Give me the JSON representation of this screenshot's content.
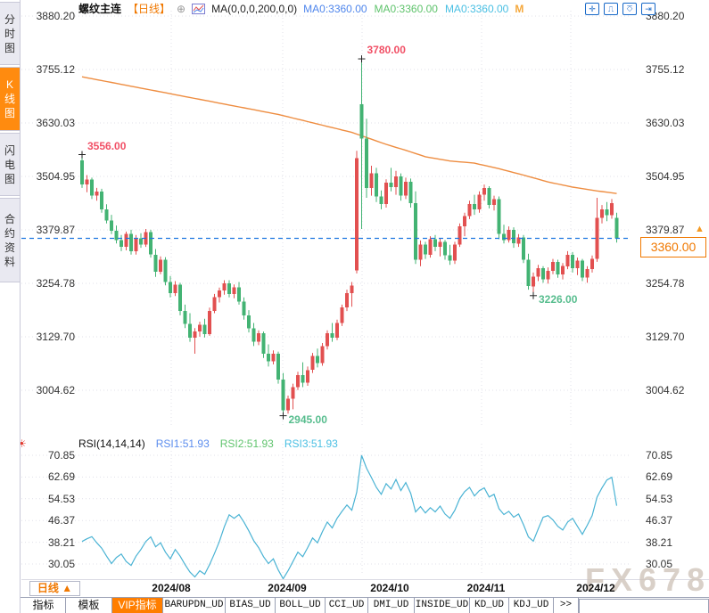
{
  "header": {
    "symbol": "螺纹主连",
    "period_tag": "【日线】",
    "add_icon": "⊕",
    "ma_settings": "MA(0,0,0,200,0,0)",
    "ma_values": [
      {
        "text": "MA0:3360.00",
        "color": "#4f86ec"
      },
      {
        "text": "MA0:3360.00",
        "color": "#5fc36c"
      },
      {
        "text": "MA0:3360.00",
        "color": "#49bfe3"
      }
    ],
    "m_label": "M",
    "toolbar_icons": [
      {
        "name": "pan-tool-icon",
        "glyph": "✛"
      },
      {
        "name": "axis-zoom-icon",
        "glyph": "⎍"
      },
      {
        "name": "axis-pan-icon",
        "glyph": "⎏"
      },
      {
        "name": "exit-chart-icon",
        "glyph": "⇥"
      }
    ]
  },
  "sidebar": {
    "tabs": [
      {
        "label": "分时图",
        "active": false
      },
      {
        "label": "K线图",
        "active": true
      },
      {
        "label": "闪电图",
        "active": false
      },
      {
        "label": "合约资料",
        "active": false
      }
    ]
  },
  "main_chart": {
    "y_labels": [
      "3880.20",
      "3755.12",
      "3630.03",
      "3504.95",
      "3379.87",
      "3254.78",
      "3129.70",
      "3004.62"
    ],
    "current_price": {
      "value": "3360.00",
      "arrow": "▲"
    },
    "annotations": [
      {
        "text": "3556.00",
        "index": 0,
        "price": 3556,
        "placement": "above",
        "color": "#f15066"
      },
      {
        "text": "3780.00",
        "index": 57,
        "price": 3780,
        "placement": "above",
        "color": "#f15066"
      },
      {
        "text": "2945.00",
        "index": 41,
        "price": 2945,
        "placement": "below",
        "color": "#57bd8e"
      },
      {
        "text": "3226.00",
        "index": 92,
        "price": 3226,
        "placement": "below",
        "color": "#57bd8e"
      }
    ]
  },
  "rsi_panel": {
    "title": "RSI(14,14,14)",
    "legend": [
      {
        "text": "RSI1:51.93",
        "color": "#5b8dee"
      },
      {
        "text": "RSI2:51.93",
        "color": "#5fc36c"
      },
      {
        "text": "RSI3:51.93",
        "color": "#49bfe3"
      }
    ],
    "y_labels": [
      "70.85",
      "62.69",
      "54.53",
      "46.37",
      "38.21",
      "30.05"
    ]
  },
  "x_axis": {
    "period_button": "日线 ▲",
    "labels": [
      "2024/08",
      "2024/09",
      "2024/10",
      "2024/11",
      "2024/12"
    ]
  },
  "bottom_tabs": {
    "items": [
      {
        "label": "指标",
        "active": false
      },
      {
        "label": "模板",
        "active": false
      },
      {
        "label": "VIP指标",
        "active": true
      },
      {
        "label": "BARUPDN_UD",
        "active": false
      },
      {
        "label": "BIAS_UD",
        "active": false
      },
      {
        "label": "BOLL_UD",
        "active": false
      },
      {
        "label": "CCI_UD",
        "active": false
      },
      {
        "label": "DMI_UD",
        "active": false
      },
      {
        "label": "INSIDE_UD",
        "active": false
      },
      {
        "label": "KD_UD",
        "active": false
      },
      {
        "label": "KDJ_UD",
        "active": false
      },
      {
        "label": ">>",
        "active": false
      }
    ]
  },
  "watermark": "FX678",
  "colors": {
    "up": "#e25050",
    "down": "#43b373",
    "ma_line": "#ee8d41",
    "rsi_line": "#4ab3d4",
    "price_line": "#1d77e0",
    "grid": "#e1e1ea",
    "accent_orange": "#f07800"
  },
  "chart_data": {
    "type": "candlestick",
    "symbol": "螺纹主连",
    "period": "日线",
    "y_range": [
      3004.62,
      3880.2
    ],
    "rsi_range": [
      30.05,
      70.85
    ],
    "candles": [
      [
        3542,
        3556,
        3478,
        3486
      ],
      [
        3486,
        3508,
        3468,
        3498
      ],
      [
        3498,
        3502,
        3452,
        3460
      ],
      [
        3460,
        3478,
        3448,
        3470
      ],
      [
        3470,
        3476,
        3420,
        3428
      ],
      [
        3428,
        3440,
        3395,
        3402
      ],
      [
        3402,
        3415,
        3370,
        3378
      ],
      [
        3378,
        3390,
        3348,
        3356
      ],
      [
        3356,
        3368,
        3330,
        3340
      ],
      [
        3340,
        3376,
        3332,
        3370
      ],
      [
        3370,
        3380,
        3322,
        3330
      ],
      [
        3330,
        3368,
        3322,
        3360
      ],
      [
        3360,
        3372,
        3338,
        3345
      ],
      [
        3345,
        3382,
        3340,
        3375
      ],
      [
        3375,
        3380,
        3315,
        3322
      ],
      [
        3322,
        3335,
        3270,
        3282
      ],
      [
        3282,
        3318,
        3276,
        3310
      ],
      [
        3310,
        3316,
        3250,
        3258
      ],
      [
        3258,
        3272,
        3222,
        3232
      ],
      [
        3232,
        3260,
        3225,
        3252
      ],
      [
        3252,
        3256,
        3180,
        3190
      ],
      [
        3190,
        3205,
        3150,
        3160
      ],
      [
        3160,
        3185,
        3118,
        3128
      ],
      [
        3128,
        3150,
        3090,
        3142
      ],
      [
        3142,
        3165,
        3130,
        3158
      ],
      [
        3158,
        3172,
        3128,
        3136
      ],
      [
        3136,
        3198,
        3132,
        3190
      ],
      [
        3190,
        3230,
        3185,
        3222
      ],
      [
        3222,
        3245,
        3210,
        3238
      ],
      [
        3238,
        3262,
        3228,
        3255
      ],
      [
        3255,
        3262,
        3222,
        3230
      ],
      [
        3230,
        3252,
        3220,
        3245
      ],
      [
        3245,
        3258,
        3205,
        3212
      ],
      [
        3212,
        3222,
        3170,
        3180
      ],
      [
        3180,
        3192,
        3140,
        3150
      ],
      [
        3150,
        3162,
        3108,
        3118
      ],
      [
        3118,
        3145,
        3110,
        3138
      ],
      [
        3138,
        3142,
        3080,
        3090
      ],
      [
        3090,
        3112,
        3060,
        3072
      ],
      [
        3072,
        3098,
        3065,
        3090
      ],
      [
        3090,
        3095,
        3020,
        3030
      ],
      [
        3030,
        3045,
        2945,
        2958
      ],
      [
        2958,
        2992,
        2950,
        2985
      ],
      [
        2985,
        3020,
        2960,
        3012
      ],
      [
        3012,
        3048,
        3005,
        3040
      ],
      [
        3040,
        3070,
        3012,
        3022
      ],
      [
        3022,
        3060,
        3015,
        3052
      ],
      [
        3052,
        3092,
        3045,
        3085
      ],
      [
        3085,
        3102,
        3058,
        3068
      ],
      [
        3068,
        3115,
        3062,
        3108
      ],
      [
        3108,
        3145,
        3100,
        3138
      ],
      [
        3138,
        3162,
        3118,
        3128
      ],
      [
        3128,
        3170,
        3122,
        3162
      ],
      [
        3162,
        3205,
        3155,
        3198
      ],
      [
        3198,
        3240,
        3190,
        3232
      ],
      [
        3232,
        3258,
        3200,
        3250
      ],
      [
        3285,
        3565,
        3278,
        3548
      ],
      [
        3674,
        3780,
        3382,
        3594
      ],
      [
        3594,
        3640,
        3455,
        3478
      ],
      [
        3478,
        3530,
        3460,
        3512
      ],
      [
        3512,
        3525,
        3445,
        3458
      ],
      [
        3458,
        3472,
        3428,
        3440
      ],
      [
        3440,
        3498,
        3432,
        3490
      ],
      [
        3490,
        3525,
        3470,
        3480
      ],
      [
        3480,
        3518,
        3462,
        3505
      ],
      [
        3505,
        3512,
        3448,
        3460
      ],
      [
        3460,
        3502,
        3452,
        3492
      ],
      [
        3492,
        3500,
        3432,
        3442
      ],
      [
        3442,
        3470,
        3300,
        3310
      ],
      [
        3310,
        3355,
        3295,
        3345
      ],
      [
        3345,
        3352,
        3312,
        3322
      ],
      [
        3322,
        3365,
        3315,
        3358
      ],
      [
        3358,
        3368,
        3330,
        3340
      ],
      [
        3340,
        3360,
        3318,
        3352
      ],
      [
        3352,
        3356,
        3310,
        3320
      ],
      [
        3320,
        3345,
        3298,
        3308
      ],
      [
        3308,
        3352,
        3300,
        3345
      ],
      [
        3345,
        3395,
        3340,
        3388
      ],
      [
        3388,
        3420,
        3365,
        3412
      ],
      [
        3412,
        3448,
        3405,
        3440
      ],
      [
        3440,
        3462,
        3415,
        3428
      ],
      [
        3428,
        3470,
        3420,
        3462
      ],
      [
        3462,
        3486,
        3448,
        3478
      ],
      [
        3478,
        3482,
        3430,
        3438
      ],
      [
        3438,
        3460,
        3425,
        3452
      ],
      [
        3452,
        3458,
        3358,
        3370
      ],
      [
        3370,
        3392,
        3348,
        3356
      ],
      [
        3356,
        3388,
        3350,
        3380
      ],
      [
        3380,
        3386,
        3338,
        3348
      ],
      [
        3348,
        3370,
        3340,
        3362
      ],
      [
        3362,
        3368,
        3302,
        3310
      ],
      [
        3310,
        3324,
        3240,
        3248
      ],
      [
        3248,
        3280,
        3226,
        3270
      ],
      [
        3270,
        3298,
        3260,
        3290
      ],
      [
        3290,
        3295,
        3256,
        3264
      ],
      [
        3264,
        3292,
        3254,
        3284
      ],
      [
        3284,
        3312,
        3276,
        3305
      ],
      [
        3305,
        3310,
        3268,
        3276
      ],
      [
        3276,
        3302,
        3264,
        3295
      ],
      [
        3295,
        3330,
        3288,
        3322
      ],
      [
        3322,
        3328,
        3280,
        3290
      ],
      [
        3290,
        3315,
        3274,
        3308
      ],
      [
        3308,
        3312,
        3260,
        3268
      ],
      [
        3268,
        3295,
        3256,
        3288
      ],
      [
        3288,
        3320,
        3280,
        3312
      ],
      [
        3312,
        3455,
        3305,
        3408
      ],
      [
        3408,
        3438,
        3395,
        3428
      ],
      [
        3428,
        3445,
        3400,
        3414
      ],
      [
        3414,
        3452,
        3406,
        3442
      ],
      [
        3408,
        3420,
        3350,
        3360
      ]
    ],
    "ma200_anchors": [
      [
        0,
        3738
      ],
      [
        10,
        3716
      ],
      [
        20,
        3694
      ],
      [
        30,
        3672
      ],
      [
        40,
        3650
      ],
      [
        50,
        3622
      ],
      [
        55,
        3608
      ],
      [
        58,
        3596
      ],
      [
        62,
        3580
      ],
      [
        66,
        3566
      ],
      [
        70,
        3551
      ],
      [
        75,
        3541
      ],
      [
        80,
        3536
      ],
      [
        85,
        3523
      ],
      [
        90,
        3508
      ],
      [
        95,
        3492
      ],
      [
        100,
        3480
      ],
      [
        105,
        3471
      ],
      [
        109,
        3465
      ]
    ],
    "rsi_values": [
      38.5,
      39.5,
      40.3,
      38.0,
      36.0,
      33.0,
      30.2,
      32.5,
      33.8,
      31.0,
      29.5,
      33.0,
      35.5,
      38.5,
      40.2,
      36.5,
      38.0,
      34.5,
      32.0,
      35.5,
      33.0,
      29.8,
      27.0,
      25.2,
      27.5,
      26.2,
      29.8,
      34.0,
      38.5,
      44.0,
      48.5,
      47.2,
      48.6,
      45.8,
      42.5,
      38.8,
      36.2,
      32.8,
      30.2,
      32.0,
      27.8,
      24.5,
      27.5,
      31.0,
      34.5,
      32.8,
      36.2,
      39.8,
      38.0,
      42.2,
      45.8,
      43.6,
      47.2,
      49.8,
      52.2,
      50.2,
      57.0,
      70.8,
      66.0,
      62.5,
      58.8,
      56.2,
      60.2,
      58.2,
      61.8,
      57.6,
      60.6,
      56.6,
      49.6,
      51.6,
      49.2,
      51.2,
      49.6,
      51.8,
      48.8,
      47.2,
      50.2,
      54.6,
      57.2,
      58.8,
      55.6,
      57.6,
      58.6,
      55.2,
      56.2,
      50.8,
      48.6,
      49.8,
      47.6,
      48.8,
      44.8,
      40.2,
      38.6,
      43.2,
      47.6,
      48.2,
      46.6,
      44.2,
      42.8,
      45.8,
      47.2,
      44.2,
      41.2,
      44.6,
      48.2,
      55.2,
      58.6,
      61.6,
      62.6,
      51.93
    ],
    "current_price": 3360.0,
    "price_line_style": "dashed-blue"
  }
}
